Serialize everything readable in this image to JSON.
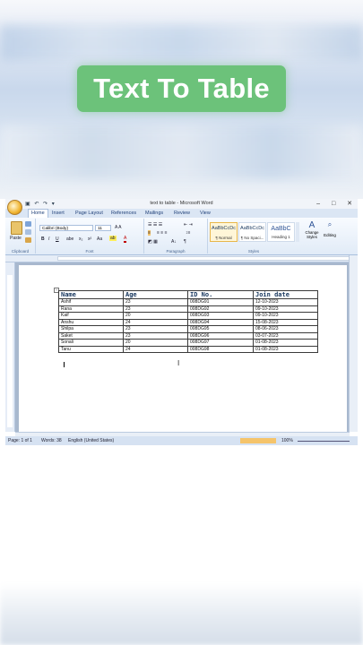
{
  "overlay_title": "Text To Table",
  "window": {
    "title": "text to table - Microsoft Word",
    "minimize": "–",
    "maximize": "□",
    "close": "✕"
  },
  "tabs": [
    "Home",
    "Insert",
    "Page Layout",
    "References",
    "Mailings",
    "Review",
    "View"
  ],
  "ribbon": {
    "paste_label": "Paste",
    "font_name": "Calibri (Body)",
    "font_size": "11",
    "groups": {
      "clipboard": "Clipboard",
      "font": "Font",
      "paragraph": "Paragraph",
      "styles": "Styles"
    },
    "styles": [
      {
        "sample": "AaBbCcDc",
        "name": "¶ Normal"
      },
      {
        "sample": "AaBbCcDc",
        "name": "¶ No Spaci..."
      },
      {
        "sample": "AaBbC",
        "name": "Heading 1"
      }
    ],
    "change_styles": "Change Styles",
    "editing": "Editing"
  },
  "table": {
    "headers": [
      "Name",
      "Age",
      "ID No.",
      "Join date"
    ],
    "rows": [
      [
        "Ashif",
        "23",
        "008DG91",
        "12-10-2023"
      ],
      [
        "Rana",
        "23",
        "008DG92",
        "09-10-2023"
      ],
      [
        "Kaif",
        "20",
        "008DG93",
        "09-10-2023"
      ],
      [
        "Anshu",
        "24",
        "008DG94",
        "15-08-2023"
      ],
      [
        "Shilpa",
        "23",
        "008DG95",
        "08-06-2023"
      ],
      [
        "Saket",
        "23",
        "008DG96",
        "03-07-2023"
      ],
      [
        "Sonali",
        "20",
        "008DG97",
        "01-08-2023"
      ],
      [
        "Tanu",
        "24",
        "008DG98",
        "01-08-2023"
      ]
    ]
  },
  "status": {
    "page": "Page: 1 of 1",
    "words": "Words: 38",
    "language": "English (United States)",
    "zoom": "100%"
  },
  "colors": {
    "badge": "#6cc27a",
    "ribbon_text": "#22427a"
  }
}
